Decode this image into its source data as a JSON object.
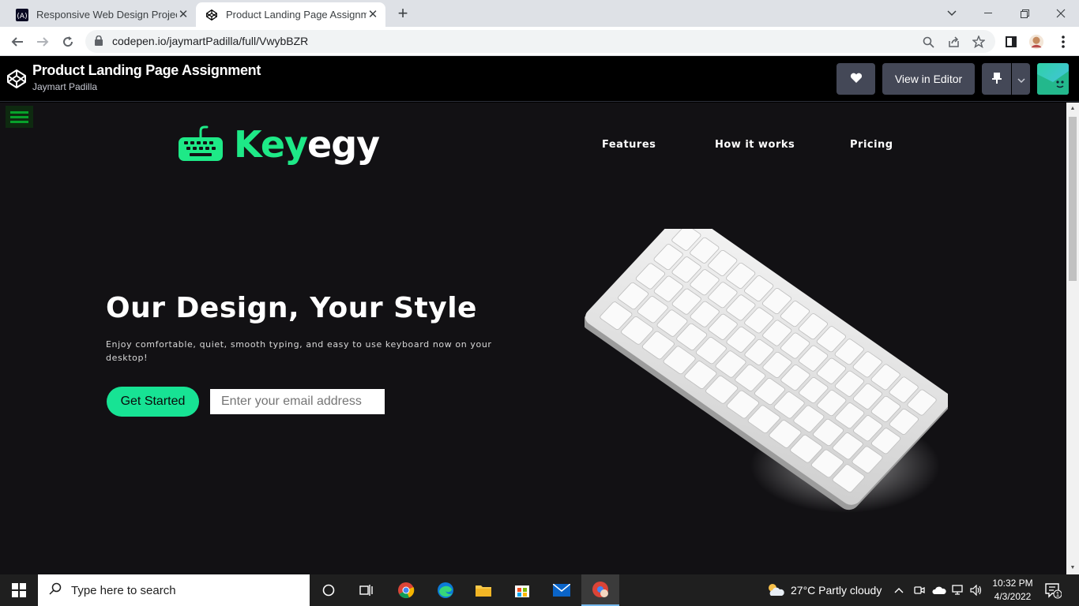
{
  "browser": {
    "tabs": [
      {
        "title": "Responsive Web Design Projects",
        "active": false
      },
      {
        "title": "Product Landing Page Assignmen",
        "active": true
      }
    ],
    "new_tab_label": "+",
    "url": "codepen.io/jaymartPadilla/full/VwybBZR"
  },
  "codepen": {
    "title": "Product Landing Page Assignment",
    "author": "Jaymart Padilla",
    "view_in_editor": "View in Editor"
  },
  "site": {
    "brand_key": "Key",
    "brand_egy": "egy",
    "nav": [
      "Features",
      "How it works",
      "Pricing"
    ],
    "hero_title": "Our Design, Your Style",
    "hero_subtitle": "Enjoy comfortable, quiet, smooth typing, and easy to use keyboard now on your desktop!",
    "cta_label": "Get Started",
    "email_placeholder": "Enter your email address",
    "accent_color": "#1ee987"
  },
  "taskbar": {
    "search_placeholder": "Type here to search",
    "weather": "27°C  Partly cloudy",
    "time": "10:32 PM",
    "date": "4/3/2022",
    "notification_count": "1"
  }
}
